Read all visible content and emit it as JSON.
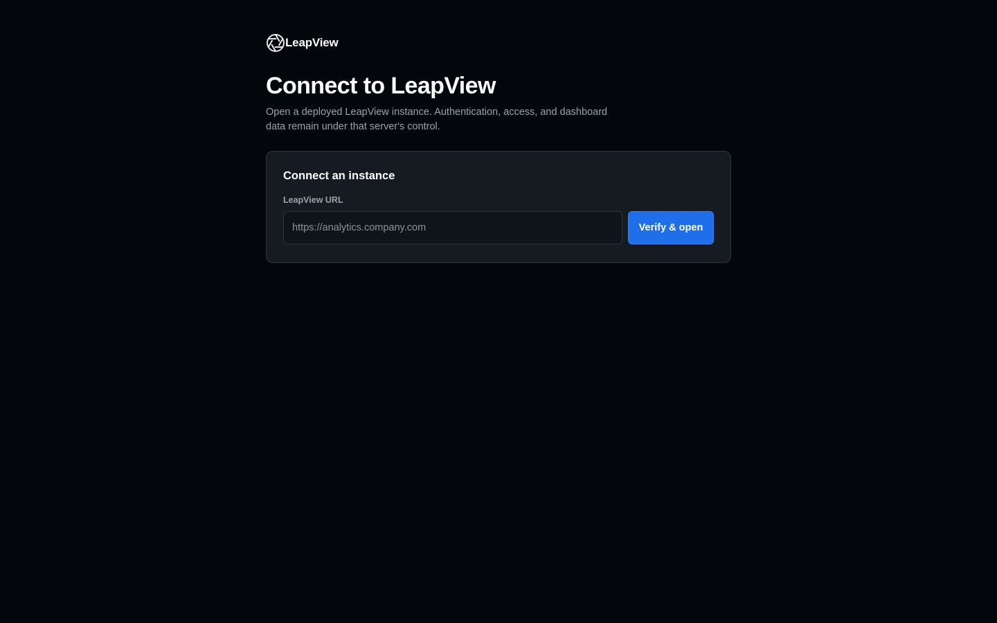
{
  "brand": {
    "name": "LeapView",
    "logo_icon": "aperture-icon"
  },
  "header": {
    "title": "Connect to LeapView",
    "subtitle": "Open a deployed LeapView instance. Authentication, access, and dashboard data remain under that server's control."
  },
  "card": {
    "title": "Connect an instance",
    "url_field": {
      "label": "LeapView URL",
      "value": "",
      "placeholder": "https://analytics.company.com"
    },
    "submit_label": "Verify & open"
  },
  "colors": {
    "background": "#03060b",
    "card": "#161b22",
    "border": "#30363d",
    "accent": "#1f6feb",
    "muted_text": "#9aa3ad"
  }
}
